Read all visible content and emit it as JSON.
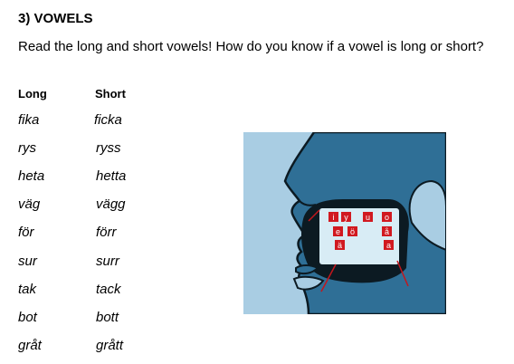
{
  "heading": "3) VOWELS",
  "question": "Read the long and short vowels! How do you know if a vowel is long or short?",
  "columns": {
    "long": "Long",
    "short": "Short"
  },
  "pairs": [
    {
      "long": "fika",
      "short": "ficka"
    },
    {
      "long": "rys",
      "short": "ryss"
    },
    {
      "long": "heta",
      "short": "hetta"
    },
    {
      "long": "väg",
      "short": "vägg"
    },
    {
      "long": "för",
      "short": "förr"
    },
    {
      "long": "sur",
      "short": "surr"
    },
    {
      "long": "tak",
      "short": "tack"
    },
    {
      "long": "bot",
      "short": "bott"
    },
    {
      "long": "gråt",
      "short": "grått"
    }
  ],
  "illustration": {
    "vowel_labels": [
      "i",
      "y",
      "u",
      "o",
      "e",
      "ö",
      "å",
      "ä",
      "a"
    ],
    "colors": {
      "background": "#a9cde3",
      "head": "#2f6f96",
      "mouth": "#0c1a22",
      "label_box": "#d11920",
      "arrow": "#c4161c"
    }
  }
}
